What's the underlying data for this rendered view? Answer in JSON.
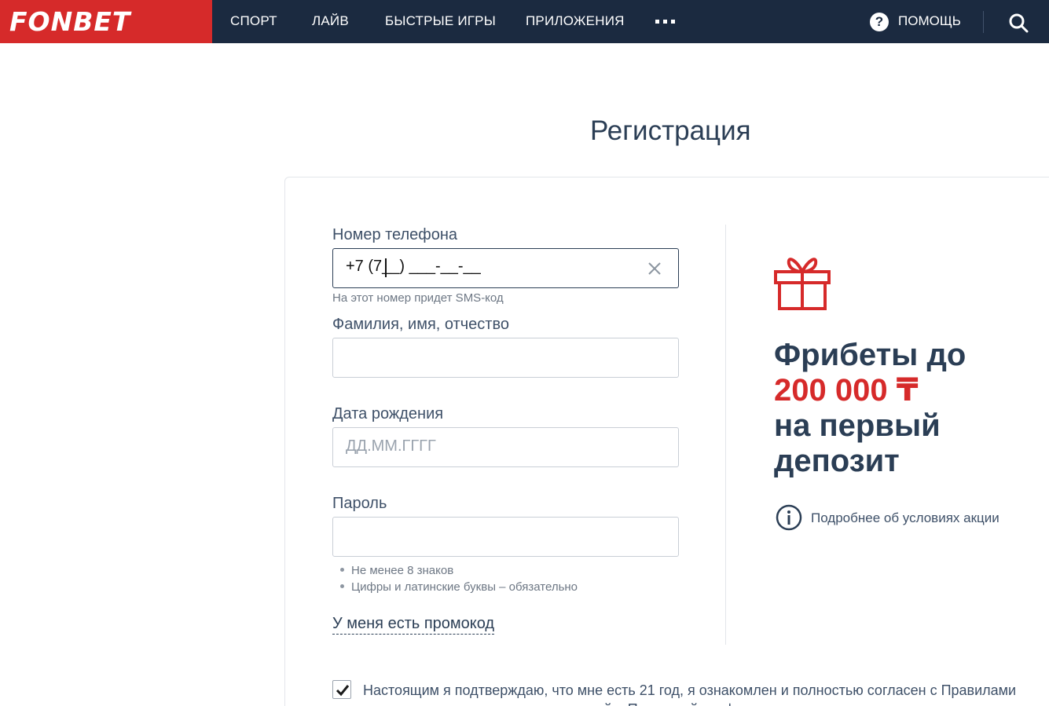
{
  "header": {
    "logo": "FONBET",
    "nav": [
      {
        "label": "СПОРТ"
      },
      {
        "label": "ЛАЙВ"
      },
      {
        "label": "БЫСТРЫЕ ИГРЫ"
      },
      {
        "label": "ПРИЛОЖЕНИЯ"
      }
    ],
    "more_icon": "more-dots-icon",
    "help_label": "ПОМОЩЬ",
    "search_icon": "search-icon"
  },
  "page": {
    "title": "Регистрация"
  },
  "form": {
    "phone": {
      "label": "Номер телефона",
      "value": "+7 (7__) ___-__-__",
      "hint": "На этот номер придет SMS-код"
    },
    "fullname": {
      "label": "Фамилия, имя, отчество",
      "value": ""
    },
    "birthdate": {
      "label": "Дата рождения",
      "placeholder": "ДД.ММ.ГГГГ"
    },
    "password": {
      "label": "Пароль",
      "rules": [
        "Не менее 8 знаков",
        "Цифры и латинские буквы – обязательно"
      ]
    },
    "promo_link": "У меня есть промокод",
    "consent": {
      "checked": true,
      "text": "Настоящим я подтверждаю, что мне есть 21 год, я ознакомлен и полностью согласен с Правилами приема ставок и выплаты выигрышей и Политикой конфиденциальности в"
    }
  },
  "promo": {
    "title_line1": "Фрибеты до",
    "amount": "200 000 ₸",
    "title_line3": "на первый",
    "title_line4": "депозит",
    "terms_link": "Подробнее об условиях акции"
  },
  "colors": {
    "brand_red": "#d62a2a",
    "header_bg": "#1b2a40",
    "text_dark": "#2b3e55"
  }
}
